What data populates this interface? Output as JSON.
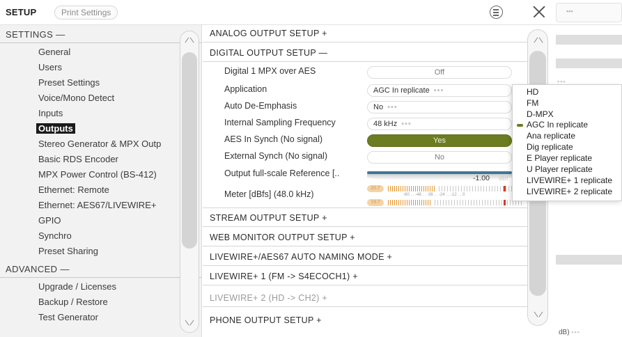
{
  "topbar": {
    "title": "SETUP",
    "print_button": "Print Settings",
    "behind_dots": "▪▪▪"
  },
  "sidebar": {
    "settings_header": "SETTINGS —",
    "settings_items": [
      "General",
      "Users",
      "Preset Settings",
      "Voice/Mono Detect",
      "Inputs",
      "Outputs",
      "Stereo Generator & MPX Outp",
      "Basic RDS Encoder",
      "MPX Power Control (BS-412)",
      "Ethernet: Remote",
      "Ethernet: AES67/LIVEWIRE+",
      "GPIO",
      "Synchro",
      "Preset Sharing"
    ],
    "selected_item": "Outputs",
    "advanced_header": "ADVANCED —",
    "advanced_items": [
      "Upgrade / Licenses",
      "Backup / Restore",
      "Test Generator"
    ]
  },
  "main": {
    "analog_header": "ANALOG OUTPUT SETUP  +",
    "digital_header": "DIGITAL OUTPUT SETUP  —",
    "rows": {
      "mpx_over_aes": {
        "label": "Digital 1 MPX over AES",
        "value": "Off"
      },
      "application": {
        "label": "Application",
        "value": "AGC In replicate"
      },
      "auto_deemphasis": {
        "label": "Auto De-Emphasis",
        "value": "No"
      },
      "sampling": {
        "label": "Internal Sampling Frequency",
        "value": "48 kHz"
      },
      "aes_synch": {
        "label": "AES In Synch (No signal)",
        "value": "Yes"
      },
      "external_synch": {
        "label": "External Synch (No signal)",
        "value": "No"
      },
      "fullscale": {
        "label": "Output full-scale Reference [..",
        "value": "-1.00",
        "unit": "dBf"
      },
      "meter": {
        "label": "Meter [dBfs] (48.0 kHz)",
        "left_value": "20.7",
        "right_value": "19.7",
        "scale": "-60 . . -48 . . -36 . . -24 . . -12 . . 0"
      }
    },
    "field_dots": "▪▪▪",
    "collapsed_groups": [
      "STREAM OUTPUT SETUP  +",
      "WEB MONITOR OUTPUT SETUP  +",
      "LIVEWIRE+/AES67 AUTO NAMING MODE  +",
      "LIVEWIRE+ 1 (FM -> S4ECOCH1)  +",
      "LIVEWIRE+ 2 (HD -> CH2)  +",
      "PHONE OUTPUT SETUP  +"
    ]
  },
  "dropdown": {
    "options": [
      "HD",
      "FM",
      "D-MPX",
      "AGC In replicate",
      "Ana replicate",
      "Dig replicate",
      "E Player replicate",
      "U Player replicate",
      "LIVEWIRE+ 1 replicate",
      "LIVEWIRE+ 2 replicate"
    ],
    "selected": "AGC In replicate"
  },
  "behind": {
    "dots": "▪▪▪",
    "bottom_text": "dB)"
  },
  "colors": {
    "accent_green": "#6b7d20",
    "selected_bg": "#1b1b1b",
    "meter_orange": "#e0962f",
    "fullscale_blue": "#3d7898"
  },
  "meter_levels": {
    "left_fraction": 0.36,
    "right_fraction": 0.33
  }
}
